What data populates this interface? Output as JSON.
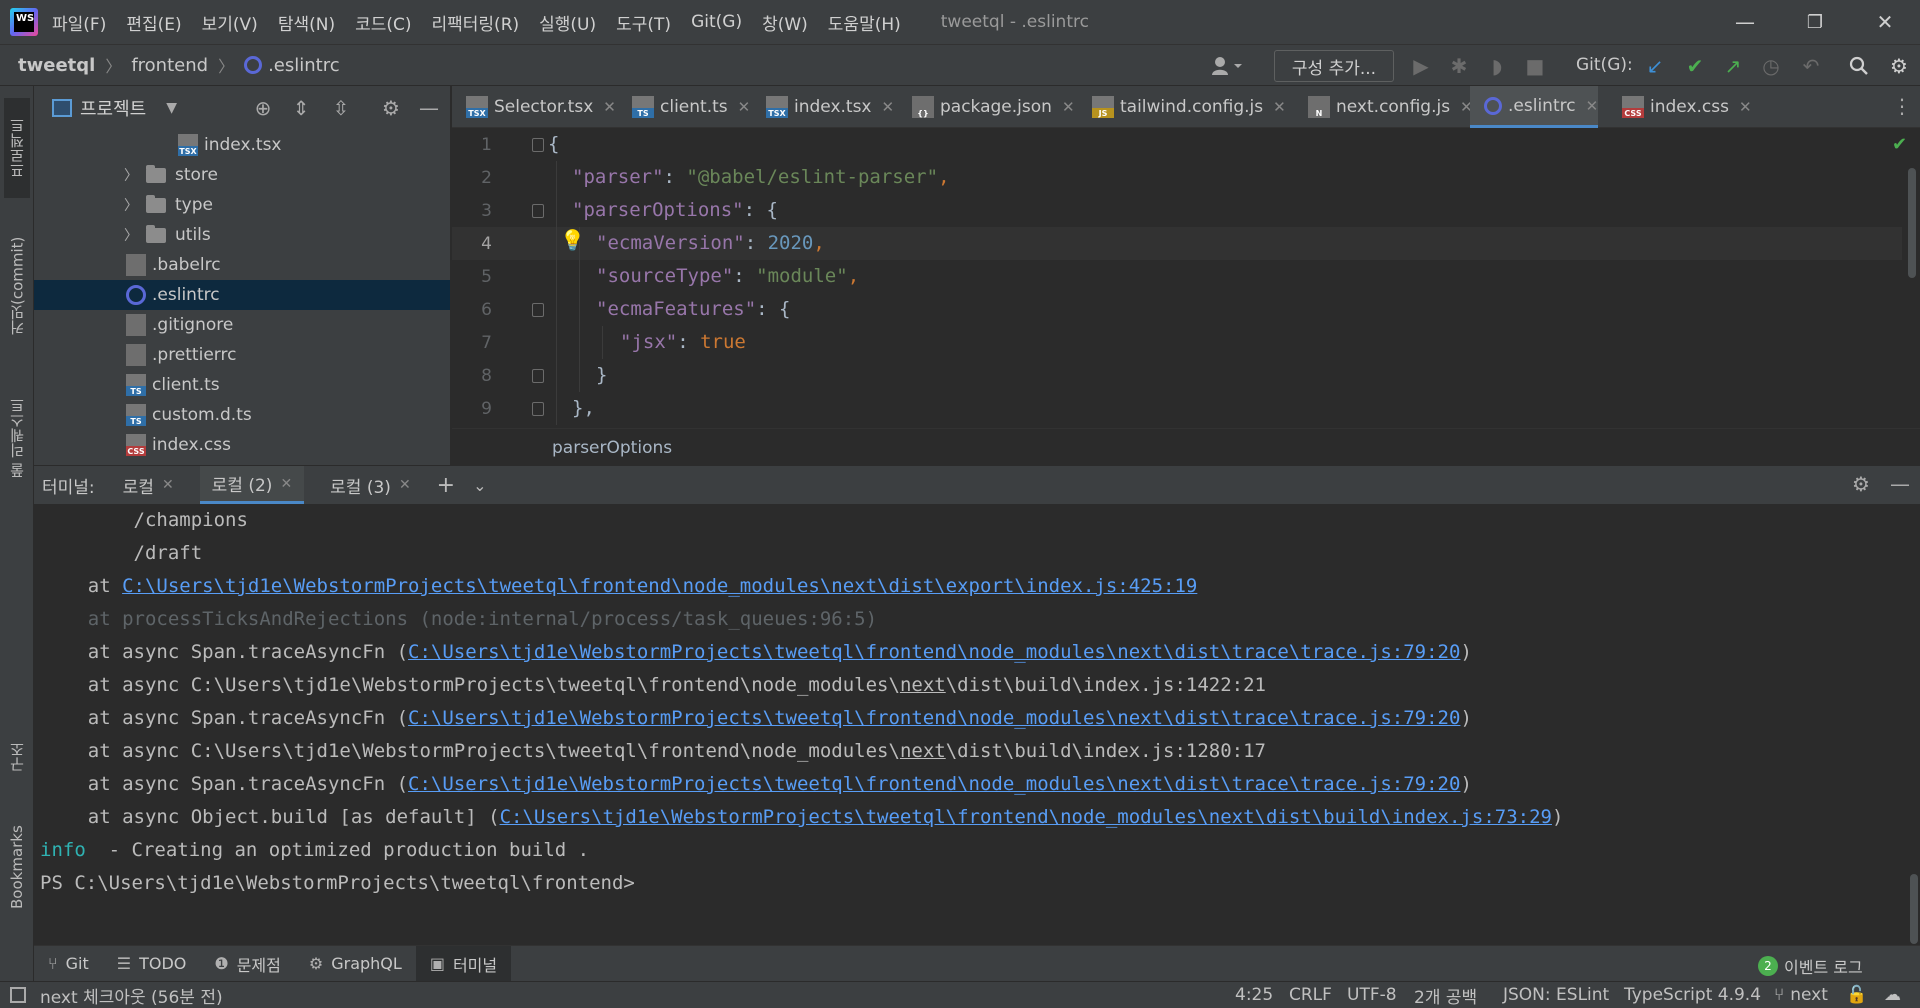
{
  "menubar": {
    "logo_text": "WS",
    "items": [
      "파일(F)",
      "편집(E)",
      "보기(V)",
      "탐색(N)",
      "코드(C)",
      "리팩터링(R)",
      "실행(U)",
      "도구(T)",
      "Git(G)",
      "창(W)",
      "도움말(H)"
    ],
    "window_title": "tweetql - .eslintrc",
    "minimize": "—",
    "restore": "❐",
    "close": "✕"
  },
  "navbar": {
    "crumbs": [
      "tweetql",
      "frontend",
      ".eslintrc"
    ],
    "config_button": "구성 추가...",
    "git_label": "Git(G):"
  },
  "left_strip": {
    "tabs": [
      "프로젝트",
      "커밋(commit)",
      "풀 리퀘스트",
      "구조",
      "Bookmarks"
    ]
  },
  "project": {
    "title": "프로젝트",
    "tree": [
      {
        "label": "index.tsx",
        "kind": "tsx",
        "icon_text": "TSX"
      },
      {
        "label": "store",
        "kind": "folder"
      },
      {
        "label": "type",
        "kind": "folder"
      },
      {
        "label": "utils",
        "kind": "folder"
      },
      {
        "label": ".babelrc",
        "kind": "cfg"
      },
      {
        "label": ".eslintrc",
        "kind": "eslint",
        "selected": true
      },
      {
        "label": ".gitignore",
        "kind": "cfg"
      },
      {
        "label": ".prettierrc",
        "kind": "cfg"
      },
      {
        "label": "client.ts",
        "kind": "ts",
        "icon_text": "TS"
      },
      {
        "label": "custom.d.ts",
        "kind": "ts",
        "icon_text": "TS"
      },
      {
        "label": "index.css",
        "kind": "css",
        "icon_text": "CSS"
      }
    ]
  },
  "editor_tabs": [
    {
      "label": "Selector.tsx",
      "kind": "tsx",
      "icon_text": "TSX"
    },
    {
      "label": "client.ts",
      "kind": "ts",
      "icon_text": "TS"
    },
    {
      "label": "index.tsx",
      "kind": "tsx",
      "icon_text": "TSX"
    },
    {
      "label": "package.json",
      "kind": "json",
      "icon_text": "{}"
    },
    {
      "label": "tailwind.config.js",
      "kind": "js",
      "icon_text": "JS"
    },
    {
      "label": "next.config.js",
      "kind": "json",
      "icon_text": "N"
    },
    {
      "label": ".eslintrc",
      "kind": "eslint",
      "icon_text": "",
      "active": true
    },
    {
      "label": "index.css",
      "kind": "css",
      "icon_text": "CSS"
    }
  ],
  "editor": {
    "line_numbers": [
      "1",
      "2",
      "3",
      "4",
      "5",
      "6",
      "7",
      "8",
      "9"
    ],
    "current_line": 4,
    "code": {
      "l1": "{",
      "l2_key": "\"parser\"",
      "l2_val": "\"@babel/eslint-parser\"",
      "l3_key": "\"parserOptions\"",
      "l4_key": "\"ecmaVersion\"",
      "l4_val": "2020",
      "l5_key": "\"sourceType\"",
      "l5_val": "\"module\"",
      "l6_key": "\"ecmaFeatures\"",
      "l7_key": "\"jsx\"",
      "l7_val": "true",
      "l8": "}",
      "l9": "},"
    },
    "breadcrumb": "parserOptions"
  },
  "terminal": {
    "label": "터미널:",
    "tabs": [
      "로컬",
      "로컬 (2)",
      "로컬 (3)"
    ],
    "active_tab": 1,
    "lines": {
      "t1": "        /champions",
      "t2": "        /draft",
      "t3_pre": "    at ",
      "t3_link": "C:\\Users\\tjd1e\\WebstormProjects\\tweetql\\frontend\\node_modules\\next\\dist\\export\\index.js:425:19",
      "t4": "    at processTicksAndRejections (node:internal/process/task_queues:96:5)",
      "t5_pre": "    at async Span.traceAsyncFn (",
      "t5_link": "C:\\Users\\tjd1e\\WebstormProjects\\tweetql\\frontend\\node_modules\\next\\dist\\trace\\trace.js:79:20",
      "t5_post": ")",
      "t6_pre": "    at async C:\\Users\\tjd1e\\WebstormProjects\\tweetql\\frontend\\node_modules\\",
      "t6_u": "next",
      "t6_post": "\\dist\\build\\index.js:1422:21",
      "t7_pre": "    at async Span.traceAsyncFn (",
      "t7_link": "C:\\Users\\tjd1e\\WebstormProjects\\tweetql\\frontend\\node_modules\\next\\dist\\trace\\trace.js:79:20",
      "t7_post": ")",
      "t8_pre": "    at async C:\\Users\\tjd1e\\WebstormProjects\\tweetql\\frontend\\node_modules\\",
      "t8_u": "next",
      "t8_post": "\\dist\\build\\index.js:1280:17",
      "t9_pre": "    at async Span.traceAsyncFn (",
      "t9_link": "C:\\Users\\tjd1e\\WebstormProjects\\tweetql\\frontend\\node_modules\\next\\dist\\trace\\trace.js:79:20",
      "t9_post": ")",
      "t10_pre": "    at async Object.build [as default] (",
      "t10_link": "C:\\Users\\tjd1e\\WebstormProjects\\tweetql\\frontend\\node_modules\\next\\dist\\build\\index.js:73:29",
      "t10_post": ")",
      "t11_info": "info",
      "t11_rest": "  - Creating an optimized production build .",
      "t12": "PS C:\\Users\\tjd1e\\WebstormProjects\\tweetql\\frontend>"
    }
  },
  "tool_tabs": [
    {
      "label": "Git",
      "icon": "git-branch-icon",
      "glyph": "⑂"
    },
    {
      "label": "TODO",
      "icon": "list-icon",
      "glyph": "☰"
    },
    {
      "label": "문제점",
      "icon": "problems-icon",
      "glyph": "❶"
    },
    {
      "label": "GraphQL",
      "icon": "graphql-icon",
      "glyph": "⚙"
    },
    {
      "label": "터미널",
      "icon": "terminal-icon",
      "glyph": "▣",
      "active": true
    }
  ],
  "event_log": {
    "count": "2",
    "label": "이벤트 로그"
  },
  "status": {
    "checkout": "next 체크아웃 (56분 전)",
    "position": "4:25",
    "line_sep": "CRLF",
    "encoding": "UTF-8",
    "indent": "2개 공백",
    "schema": "JSON: ESLint",
    "ts_version": "TypeScript 4.9.4",
    "branch": "next"
  }
}
